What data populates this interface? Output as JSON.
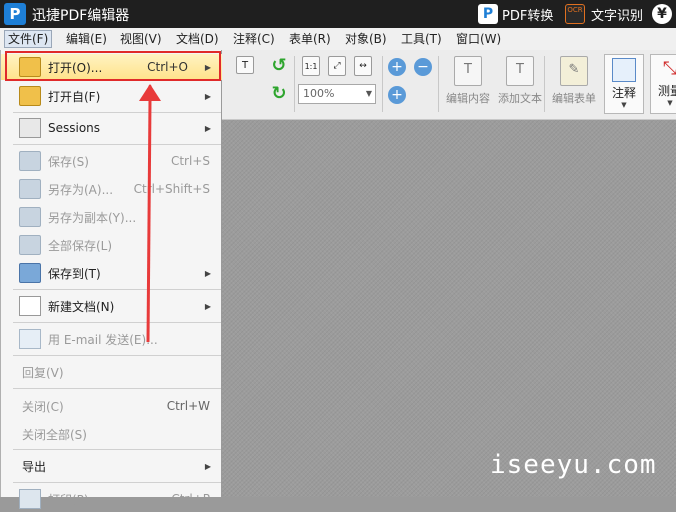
{
  "titlebar": {
    "app_title": "迅捷PDF编辑器",
    "logo_letter": "P",
    "pdf_convert": "PDF转换",
    "ocr": "文字识别",
    "ocr_badge": "OCR",
    "yuan": "¥"
  },
  "menubar": [
    "文件(F)",
    "编辑(E)",
    "视图(V)",
    "文档(D)",
    "注释(C)",
    "表单(R)",
    "对象(B)",
    "工具(T)",
    "窗口(W)"
  ],
  "toolbar": {
    "zoom_value": "100%",
    "edit_content": "编辑内容",
    "add_text": "添加文本",
    "edit_form": "编辑表单",
    "note": "注释",
    "measure": "测量"
  },
  "file_menu": {
    "open": {
      "label": "打开(O)...",
      "shortcut": "Ctrl+O"
    },
    "open_from": {
      "label": "打开自(F)"
    },
    "sessions": {
      "label": "Sessions"
    },
    "save": {
      "label": "保存(S)",
      "shortcut": "Ctrl+S"
    },
    "save_as": {
      "label": "另存为(A)...",
      "shortcut": "Ctrl+Shift+S"
    },
    "save_copy": {
      "label": "另存为副本(Y)..."
    },
    "save_all": {
      "label": "全部保存(L)"
    },
    "save_to": {
      "label": "保存到(T)"
    },
    "new_doc": {
      "label": "新建文档(N)"
    },
    "email": {
      "label": "用 E-mail 发送(E)..."
    },
    "revert": {
      "label": "回复(V)"
    },
    "close": {
      "label": "关闭(C)",
      "shortcut": "Ctrl+W"
    },
    "close_all": {
      "label": "关闭全部(S)"
    },
    "export": {
      "label": "导出"
    },
    "print": {
      "label": "打印(P)...",
      "shortcut": "Ctrl+P"
    }
  },
  "watermark": "iseeyu.com",
  "colors": {
    "highlight_border": "#e02a2a",
    "arrow": "#e83a3a",
    "titlebar": "#1f1f1f"
  }
}
